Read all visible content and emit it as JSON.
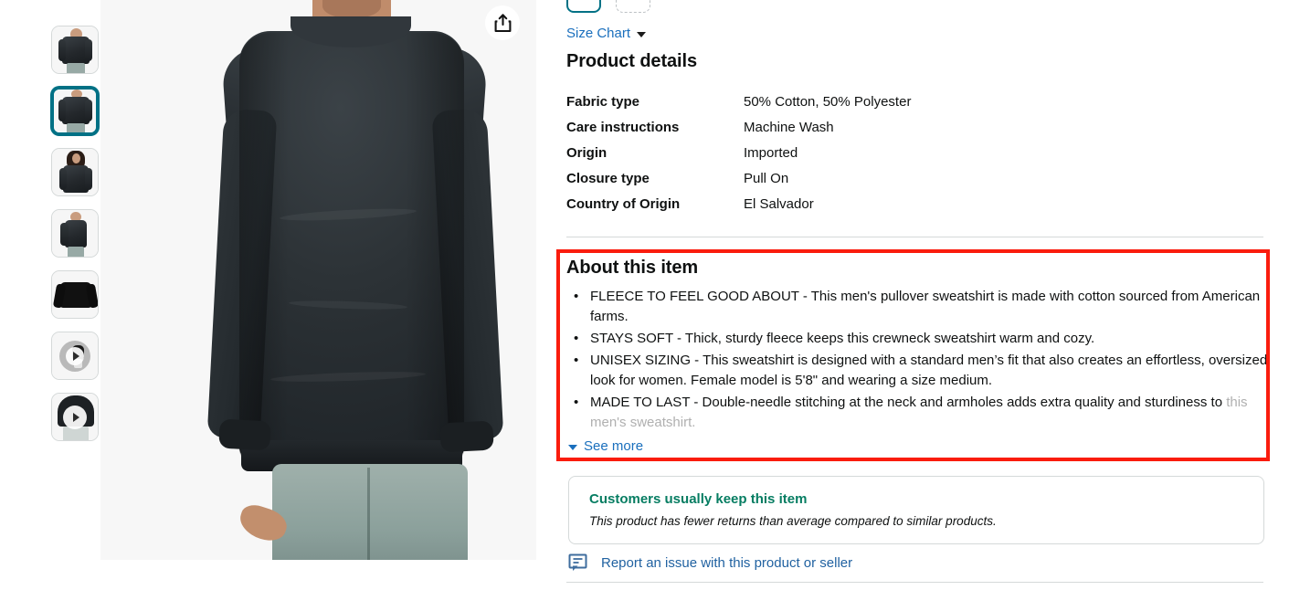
{
  "gallery": {
    "share_icon": "share-icon",
    "thumbnails": [
      {
        "alt": "Front view on male model",
        "type": "image",
        "selected": false
      },
      {
        "alt": "Back view on male model",
        "type": "image",
        "selected": true
      },
      {
        "alt": "Front view on female model",
        "type": "image",
        "selected": false
      },
      {
        "alt": "Side view on male model",
        "type": "image",
        "selected": false
      },
      {
        "alt": "Flat lay of sweatshirt",
        "type": "image",
        "selected": false
      },
      {
        "alt": "Product video 1",
        "type": "video",
        "selected": false
      },
      {
        "alt": "Product video 2",
        "type": "video",
        "selected": false
      }
    ],
    "main_image_alt": "Back view of man wearing dark charcoal crewneck sweatshirt"
  },
  "swatches": {
    "selected_index": 0,
    "options": [
      {
        "label": "",
        "state": "selected"
      },
      {
        "label": "",
        "state": "unselected"
      }
    ]
  },
  "size_chart": {
    "label": "Size Chart",
    "icon": "chevron-down-icon"
  },
  "product_details": {
    "title": "Product details",
    "rows": [
      {
        "key": "Fabric type",
        "value": "50% Cotton, 50% Polyester"
      },
      {
        "key": "Care instructions",
        "value": "Machine Wash"
      },
      {
        "key": "Origin",
        "value": "Imported"
      },
      {
        "key": "Closure type",
        "value": "Pull On"
      },
      {
        "key": "Country of Origin",
        "value": "El Salvador"
      }
    ]
  },
  "about": {
    "title": "About this item",
    "bullets": [
      "FLEECE TO FEEL GOOD ABOUT - This men's pullover sweatshirt is made with cotton sourced from American farms.",
      "STAYS SOFT - Thick, sturdy fleece keeps this crewneck sweatshirt warm and cozy.",
      "UNISEX SIZING - This sweatshirt is designed with a standard men’s fit that also creates an effortless, oversized look for women. Female model is 5'8\" and wearing a size medium.",
      "MADE TO LAST - Double-needle stitching at the neck and armholes adds extra quality and sturdiness to this men's sweatshirt."
    ],
    "see_more_label": "See more",
    "see_more_icon": "chevron-down-icon",
    "highlight_color": "#fa1c0d"
  },
  "keep_item": {
    "title": "Customers usually keep this item",
    "subtitle": "This product has fewer returns than average compared to similar products.",
    "title_color": "#067d62"
  },
  "report": {
    "label": "Report an issue with this product or seller",
    "icon": "report-speech-bubble-icon",
    "link_color": "#2162a1"
  }
}
